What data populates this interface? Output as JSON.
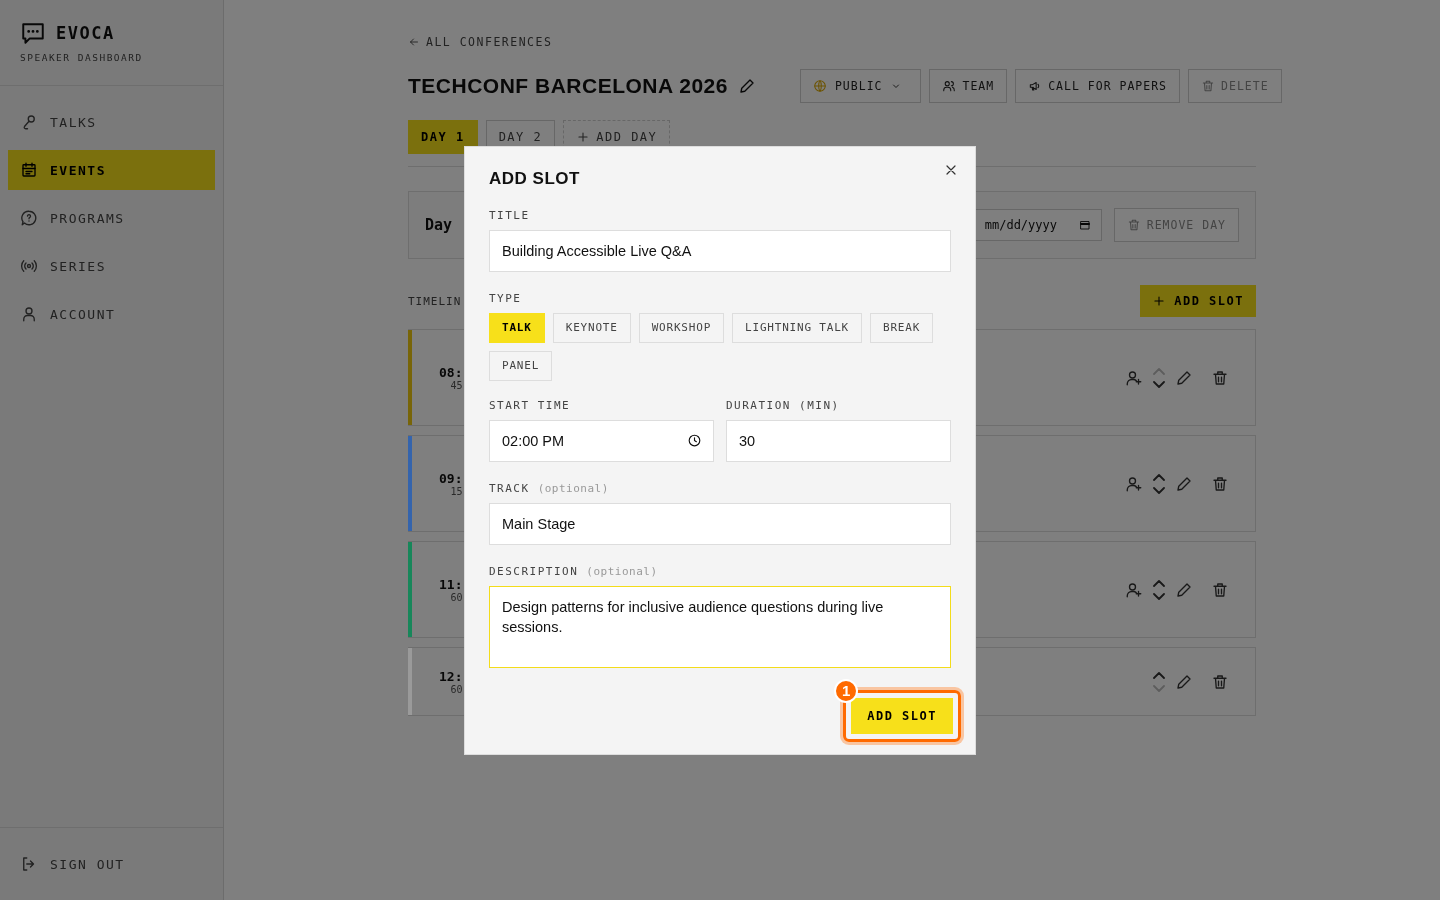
{
  "sidebar": {
    "brand": "EVOCA",
    "subtitle": "SPEAKER DASHBOARD",
    "items": [
      {
        "label": "TALKS",
        "selected": false
      },
      {
        "label": "EVENTS",
        "selected": true
      },
      {
        "label": "PROGRAMS",
        "selected": false
      },
      {
        "label": "SERIES",
        "selected": false
      },
      {
        "label": "ACCOUNT",
        "selected": false
      }
    ],
    "sign_out": "SIGN OUT"
  },
  "back_link": "ALL CONFERENCES",
  "conference": {
    "title": "TECHCONF BARCELONA 2026",
    "actions": [
      {
        "label": "PUBLIC",
        "kind": "dropdown"
      },
      {
        "label": "TEAM",
        "kind": "plain"
      },
      {
        "label": "CALL FOR PAPERS",
        "kind": "plain"
      },
      {
        "label": "DELETE",
        "kind": "muted"
      }
    ]
  },
  "day_tabs": [
    {
      "label": "DAY 1",
      "kind": "day",
      "selected": true
    },
    {
      "label": "DAY 2",
      "kind": "day",
      "selected": false
    },
    {
      "label": "ADD DAY",
      "kind": "add",
      "selected": false
    }
  ],
  "day_card": {
    "title": "Day",
    "date_placeholder": "mm/dd/yyyy",
    "remove_button": "REMOVE DAY"
  },
  "timeline": {
    "label": "TIMELIN",
    "add_button": "ADD SLOT",
    "slots": [
      {
        "time": "08:",
        "duration": "45",
        "color": "#786508",
        "speaker_action": true,
        "can_move_up": false,
        "can_move_down": true
      },
      {
        "time": "09:",
        "duration": "15",
        "color": "#3464ad",
        "speaker_action": true,
        "can_move_up": true,
        "can_move_down": true
      },
      {
        "time": "11:",
        "duration": "60",
        "color": "#17875a",
        "speaker_action": true,
        "can_move_up": true,
        "can_move_down": true
      },
      {
        "time": "12:",
        "duration": "60",
        "color": "#9a9a9a",
        "speaker_action": false,
        "can_move_up": true,
        "can_move_down": false
      }
    ]
  },
  "modal": {
    "title": "ADD SLOT",
    "title_label": "TITLE",
    "title_value": "Building Accessible Live Q&A",
    "type_label": "TYPE",
    "types": [
      {
        "label": "TALK",
        "selected": true
      },
      {
        "label": "KEYNOTE",
        "selected": false
      },
      {
        "label": "WORKSHOP",
        "selected": false
      },
      {
        "label": "LIGHTNING TALK",
        "selected": false
      },
      {
        "label": "BREAK",
        "selected": false
      },
      {
        "label": "PANEL",
        "selected": false
      }
    ],
    "start_label": "START TIME",
    "start_value": "02:00 PM",
    "duration_label": "DURATION (MIN)",
    "duration_value": "30",
    "track_label": "TRACK",
    "track_hint": "(optional)",
    "track_value": "Main Stage",
    "description_label": "DESCRIPTION",
    "description_hint": "(optional)",
    "description_value": "Design patterns for inclusive audience questions during live sessions.",
    "description_focused": true,
    "submit": {
      "label": "ADD SLOT",
      "marker": "1"
    }
  }
}
